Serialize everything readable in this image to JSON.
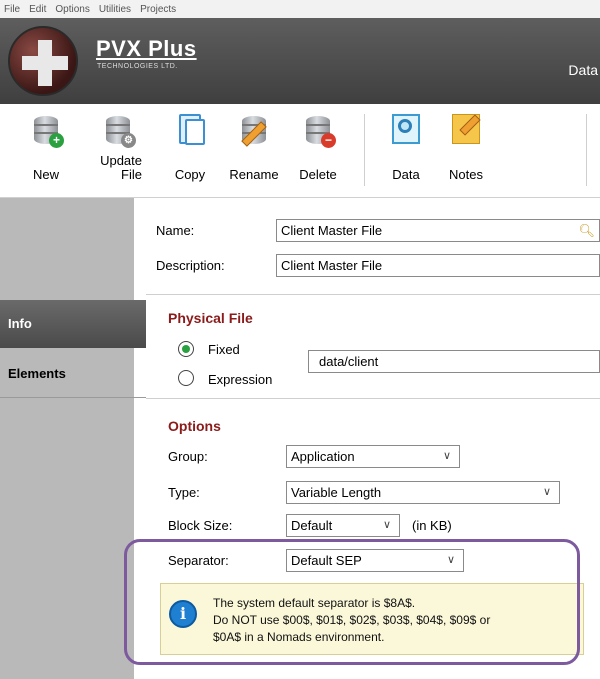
{
  "menu": [
    "File",
    "Edit",
    "Options",
    "Utilities",
    "Projects"
  ],
  "banner": {
    "brand": "PVX Plus",
    "brand_sub": "TECHNOLOGIES LTD.",
    "right_title": "Data"
  },
  "toolbar": {
    "new": "New",
    "update_file": "Update File",
    "copy": "Copy",
    "rename": "Rename",
    "delete": "Delete",
    "data": "Data",
    "notes": "Notes"
  },
  "sidebar": {
    "info": "Info",
    "elements": "Elements"
  },
  "form": {
    "name_label": "Name:",
    "name_value": "Client Master File",
    "description_label": "Description:",
    "description_value": "Client Master File"
  },
  "physical_file": {
    "title": "Physical File",
    "fixed_label": "Fixed",
    "expression_label": "Expression",
    "path_value": "data/client",
    "selected": "Fixed"
  },
  "options": {
    "title": "Options",
    "group_label": "Group:",
    "group_value": "Application",
    "type_label": "Type:",
    "type_value": "Variable Length",
    "block_size_label": "Block Size:",
    "block_size_value": "Default",
    "block_size_unit": "(in KB)",
    "separator_label": "Separator:",
    "separator_value": "Default SEP"
  },
  "info_message": {
    "line1": "The system default separator is $8A$.",
    "line2": "Do NOT use $00$, $01$, $02$, $03$, $04$, $09$ or",
    "line3": "$0A$ in a Nomads environment."
  },
  "colors": {
    "section_title": "#8b1a1a",
    "sidebar_bg": "#b9b9b9",
    "highlight_border": "#7d5a9e",
    "info_bg": "#fbf7d9"
  }
}
